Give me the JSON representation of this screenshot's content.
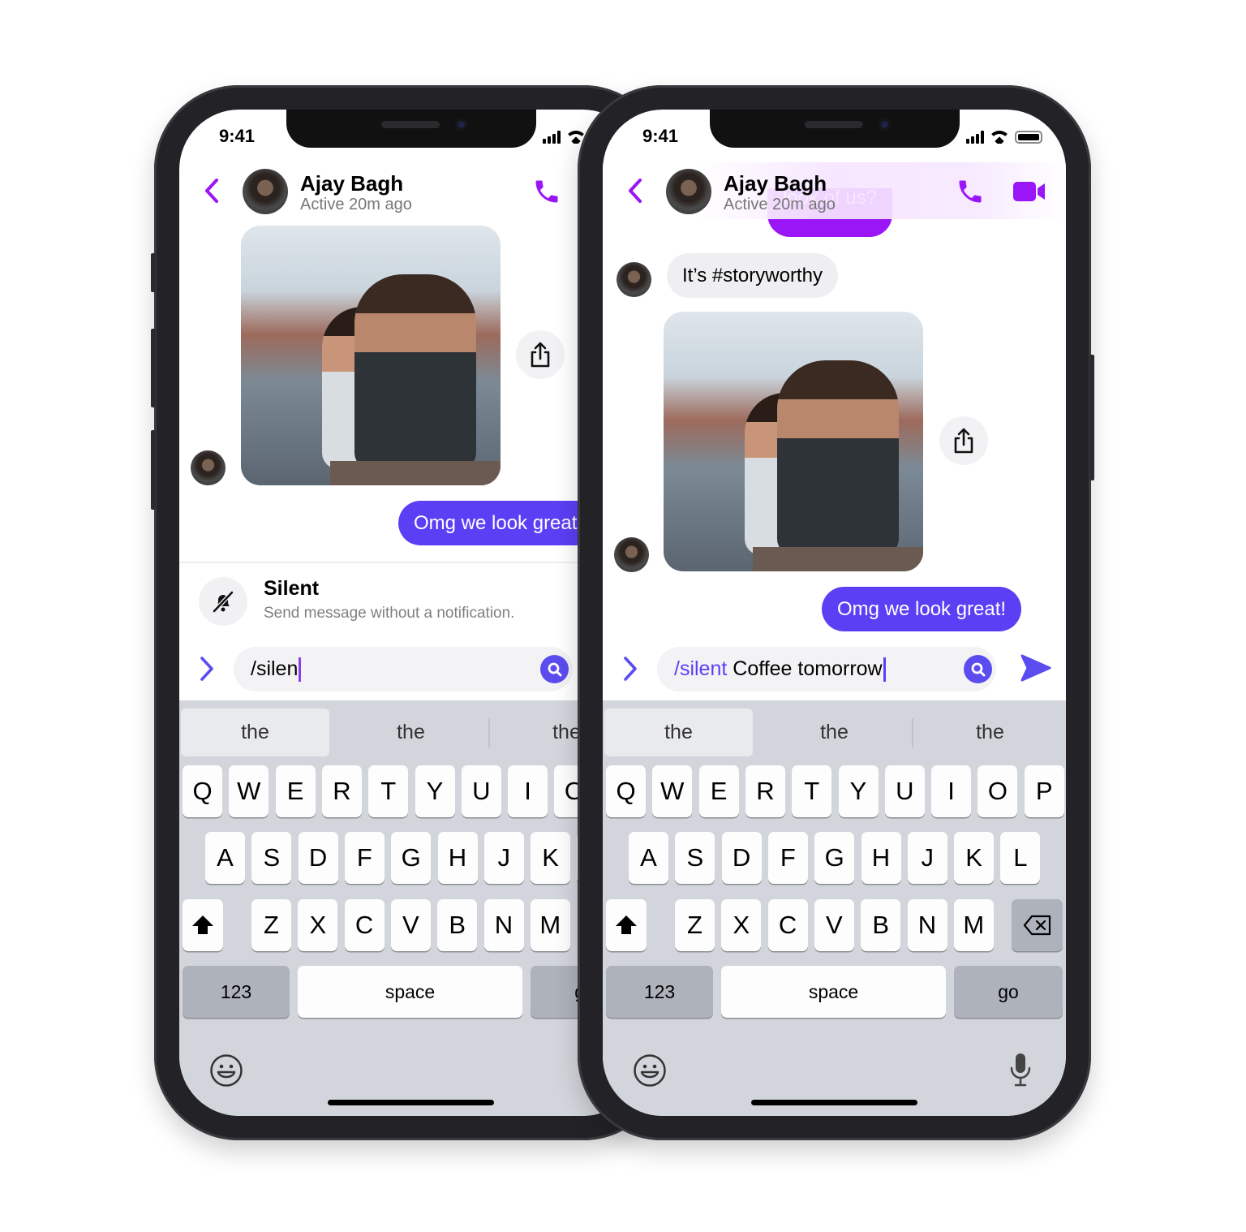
{
  "colors": {
    "accent_purple": "#9b16f6",
    "bubble_blue": "#5b3ff5",
    "search_blue": "#5b4cf0",
    "keyboard_bg": "#d2d5db"
  },
  "phones": [
    {
      "status": {
        "time": "9:41"
      },
      "header": {
        "name": "Ajay Bagh",
        "status": "Active 20m ago",
        "icons": [
          "back-chevron-icon",
          "phone-icon"
        ]
      },
      "messages": {
        "sent": "Omg we look great!"
      },
      "command": {
        "title": "Silent",
        "description": "Send message without a notification.",
        "icon": "bell-slash-icon"
      },
      "input": {
        "command": "",
        "text": "/silen"
      },
      "suggestions": [
        "the",
        "the",
        "the"
      ]
    },
    {
      "status": {
        "time": "9:41"
      },
      "header": {
        "name": "Ajay Bagh",
        "status": "Active 20m ago",
        "icons": [
          "back-chevron-icon",
          "phone-icon",
          "video-camera-icon"
        ]
      },
      "messages": {
        "top_partial": "look of us?",
        "received": "It’s #storyworthy",
        "sent": "Omg we look great!"
      },
      "input": {
        "command": "/silent",
        "text": " Coffee tomorrow"
      },
      "suggestions": [
        "the",
        "the",
        "the"
      ]
    }
  ],
  "keyboard": {
    "row1": [
      "Q",
      "W",
      "E",
      "R",
      "T",
      "Y",
      "U",
      "I",
      "O",
      "P"
    ],
    "row2": [
      "A",
      "S",
      "D",
      "F",
      "G",
      "H",
      "J",
      "K",
      "L"
    ],
    "row3": [
      "Z",
      "X",
      "C",
      "V",
      "B",
      "N",
      "M"
    ],
    "numbers": "123",
    "space": "space",
    "go": "go"
  }
}
